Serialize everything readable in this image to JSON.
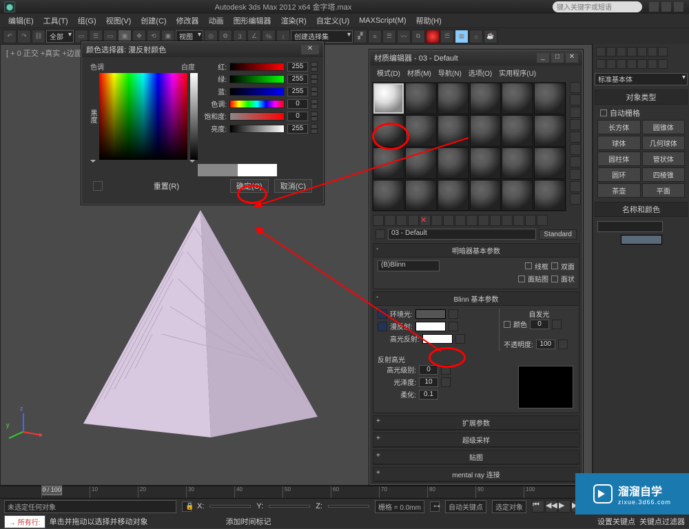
{
  "title": "Autodesk 3ds Max 2012 x64   金字塔.max",
  "search_placeholder": "键入关键字或短语",
  "menus": [
    "编辑(E)",
    "工具(T)",
    "组(G)",
    "视图(V)",
    "创建(C)",
    "修改器",
    "动画",
    "图形编辑器",
    "渲染(R)",
    "自定义(U)",
    "MAXScript(M)",
    "帮助(H)"
  ],
  "toolbar": {
    "set_select": "全部",
    "view_select": "视图",
    "selection_set": "创建选择集"
  },
  "viewport": {
    "label": "[ + 0 正交 +真实 +边面 ]"
  },
  "color_picker": {
    "title": "颜色选择器: 漫反射颜色",
    "hue_label": "色调",
    "white_label": "白度",
    "black_label": "黑度",
    "rows": [
      {
        "lbl": "红:",
        "val": "255"
      },
      {
        "lbl": "绿:",
        "val": "255"
      },
      {
        "lbl": "蓝:",
        "val": "255"
      },
      {
        "lbl": "色调:",
        "val": "0"
      },
      {
        "lbl": "饱和度:",
        "val": "0"
      },
      {
        "lbl": "亮度:",
        "val": "255"
      }
    ],
    "reset": "重置(R)",
    "ok": "确定(O)",
    "cancel": "取消(C)"
  },
  "mat_editor": {
    "title": "材质编辑器 - 03 - Default",
    "menus": [
      "模式(D)",
      "材质(M)",
      "导航(N)",
      "选项(O)",
      "实用程序(U)"
    ],
    "current": "03 - Default",
    "standard": "Standard",
    "rollouts": {
      "shader_title": "明暗器基本参数",
      "shader": "(B)Blinn",
      "wire": "线框",
      "two_sided": "双面",
      "face_map": "面贴图",
      "faceted": "面状",
      "blinn_title": "Blinn 基本参数",
      "self_illum": "自发光",
      "color": "颜色",
      "color_val": "0",
      "ambient": "环境光:",
      "diffuse": "漫反射:",
      "specular": "高光反射:",
      "opacity": "不透明度:",
      "opacity_val": "100",
      "spec_hl": "反射高光",
      "spec_level": "高光级别:",
      "spec_level_val": "0",
      "gloss": "光泽度:",
      "gloss_val": "10",
      "soften": "柔化:",
      "soften_val": "0.1",
      "ext": "扩展参数",
      "ss": "超级采样",
      "maps": "贴图",
      "mr": "mental ray 连接"
    }
  },
  "right": {
    "panel_select": "标准基本体",
    "obj_type": "对象类型",
    "auto_grid": "自动栅格",
    "geoms": [
      [
        "长方体",
        "圆锥体"
      ],
      [
        "球体",
        "几何球体"
      ],
      [
        "圆柱体",
        "管状体"
      ],
      [
        "圆环",
        "四棱锥"
      ],
      [
        "茶壶",
        "平面"
      ]
    ],
    "name_color": "名称和颜色"
  },
  "timeline": {
    "frame": "0 / 100",
    "none_sel": "未选定任何对象",
    "hint": "单击并拖动以选择并移动对象",
    "grid": "栅格 = 0.0mm",
    "auto_key": "自动关键点",
    "sel_obj": "选定对象",
    "set_key": "设置关键点",
    "key_filter": "关键点过滤器",
    "add_marker": "添加时间标记",
    "all_rows": "→ 所有行:",
    "playback": [
      "⏮",
      "◀◀",
      "▶",
      "▶▶",
      "⏭"
    ]
  },
  "watermark": {
    "big": "溜溜自学",
    "small": "zixue.3d66.com"
  }
}
